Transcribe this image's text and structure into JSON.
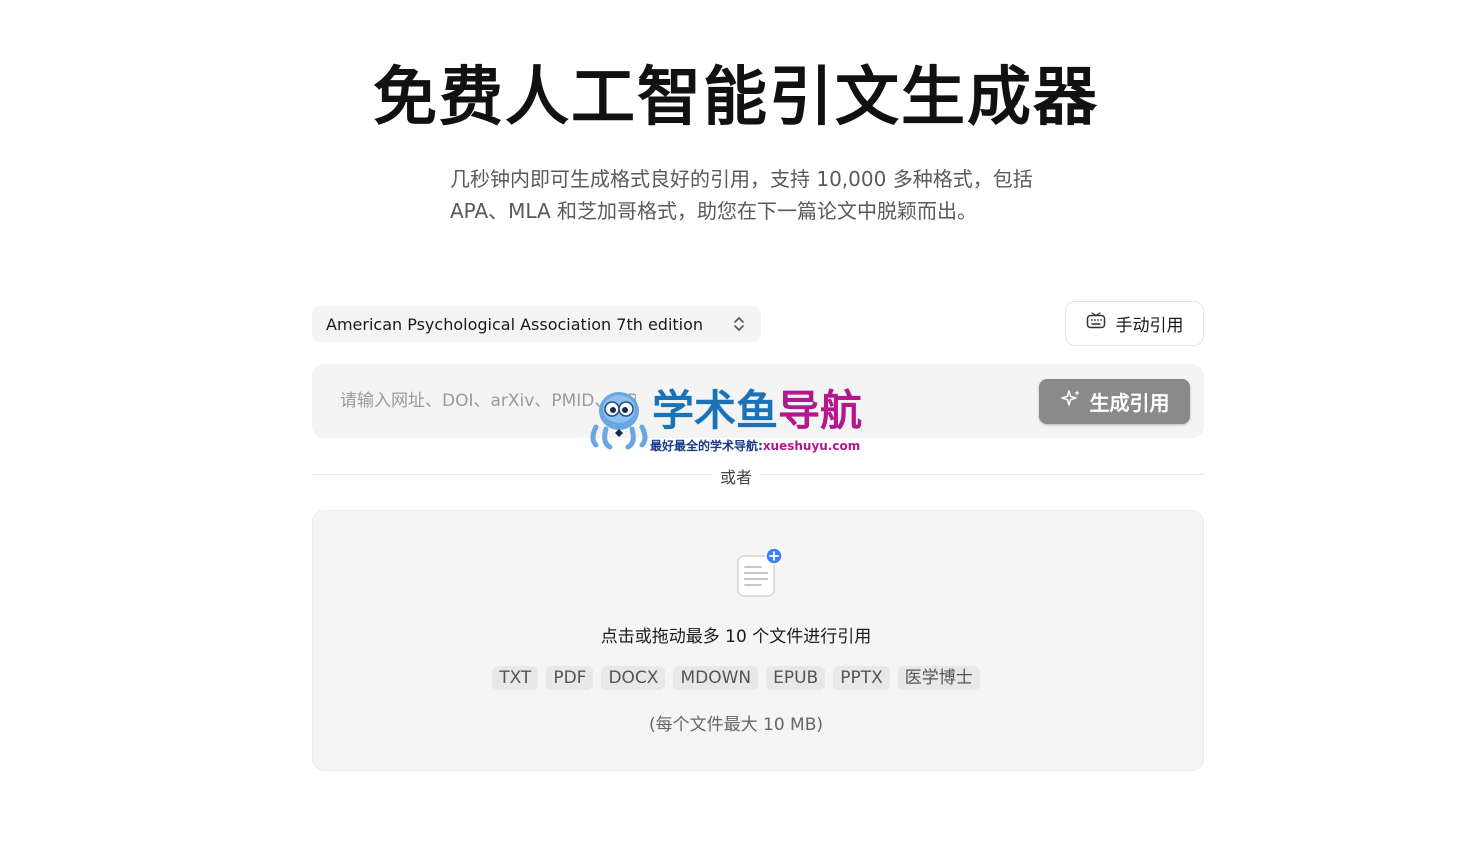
{
  "hero": {
    "title": "免费人工智能引文生成器",
    "subtitle": "几秒钟内即可生成格式良好的引用，支持 10,000 多种格式，包括 APA、MLA 和芝加哥格式，助您在下一篇论文中脱颖而出。"
  },
  "controls": {
    "style_select": "American Psychological Association 7th edition",
    "manual_button": "手动引用",
    "input_placeholder": "请输入网址、DOI、arXiv、PMID、ISBN",
    "input_value": "",
    "generate_button": "生成引用"
  },
  "watermark": {
    "title_part1": "学术鱼",
    "title_part2": "导航",
    "subtitle_part1": "最好最全的学术导航:",
    "subtitle_part2": "xueshuyu.com"
  },
  "divider_label": "或者",
  "dropzone": {
    "text": "点击或拖动最多 10 个文件进行引用",
    "formats": [
      "TXT",
      "PDF",
      "DOCX",
      "MDOWN",
      "EPUB",
      "PPTX",
      "医学博士"
    ],
    "size_note": "(每个文件最大 10 MB)"
  },
  "colors": {
    "accent_blue": "#3b82f6",
    "generate_bg": "#8a8a8a",
    "watermark_blue": "#1a73b8",
    "watermark_magenta": "#b5178f"
  }
}
